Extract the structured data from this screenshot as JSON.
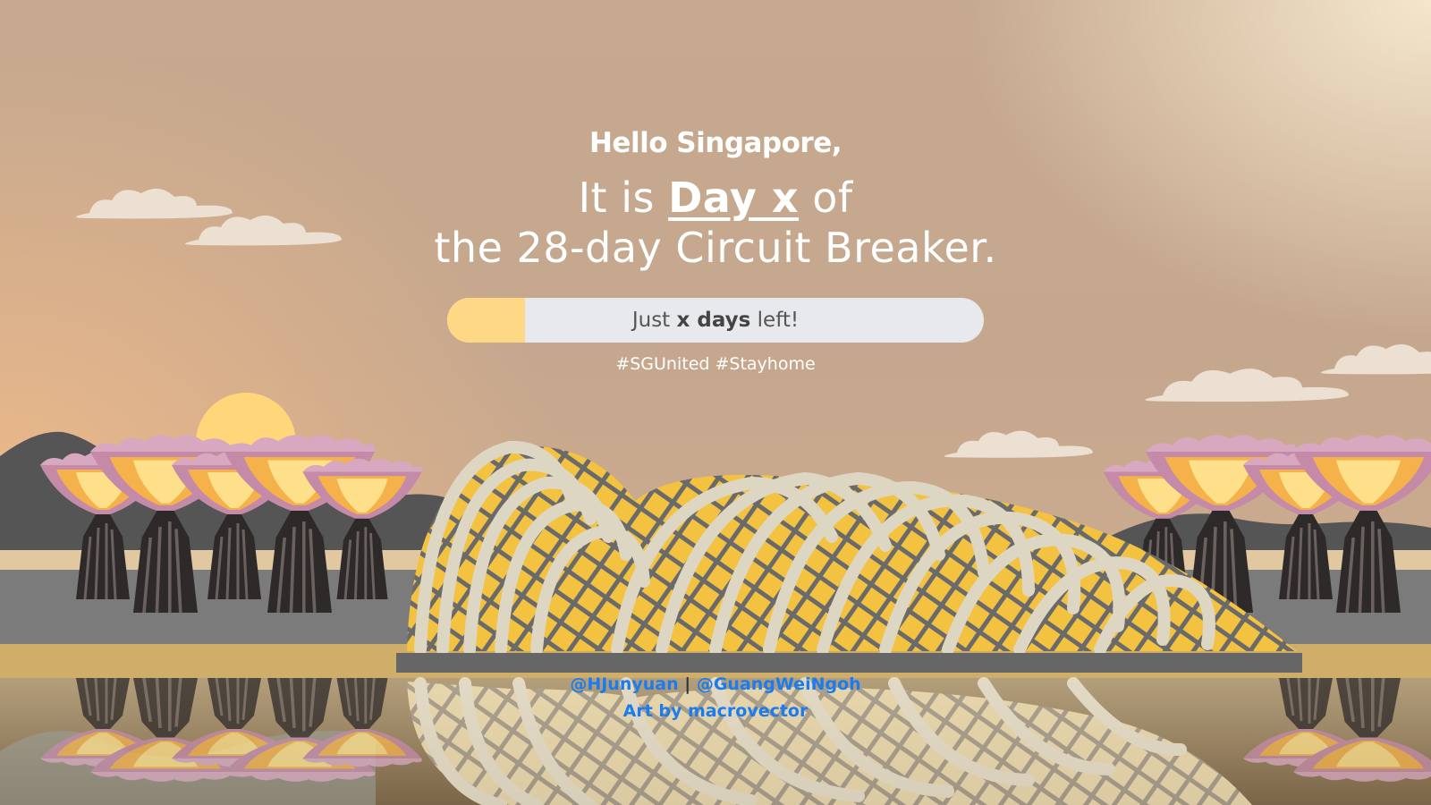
{
  "greeting": "Hello Singapore,",
  "headline": {
    "prefix": "It is",
    "day_label": "Day x",
    "suffix": "of",
    "line2": "the 28-day Circuit Breaker."
  },
  "progress": {
    "fraction": 0.145,
    "text_prefix": "Just",
    "text_bold": "x days",
    "text_suffix": "left!"
  },
  "hashtags": "#SGUnited #Stayhome",
  "credits": {
    "author1": "@HJunyuan",
    "separator": "|",
    "author2": "@GuangWeiNgoh",
    "art": "Art by macrovector"
  },
  "colors": {
    "progress_fill": "#ffd886",
    "progress_track": "#e8e9ec",
    "link": "#1a7cf0",
    "sun": "#ffd77a"
  }
}
